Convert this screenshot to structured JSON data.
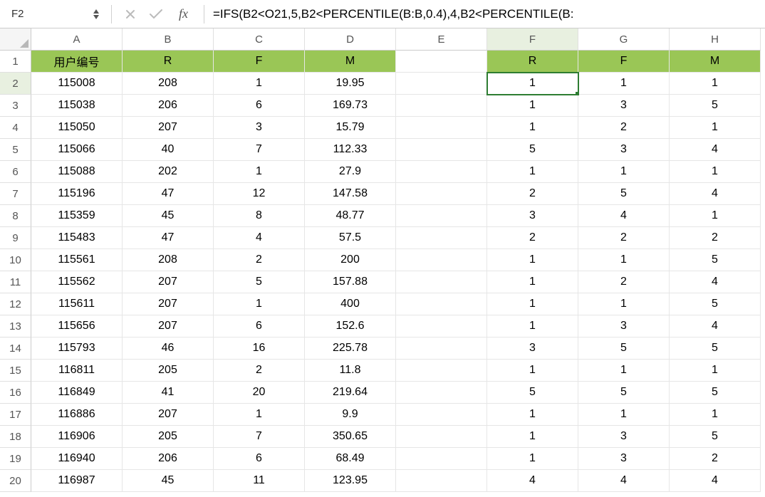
{
  "nameBox": "F2",
  "formula": "=IFS(B2<O21,5,B2<PERCENTILE(B:B,0.4),4,B2<PERCENTILE(B:",
  "columns": [
    "A",
    "B",
    "C",
    "D",
    "E",
    "F",
    "G",
    "H"
  ],
  "activeCol": "F",
  "activeRow": 2,
  "headerRow": {
    "A": "用户编号",
    "B": "R",
    "C": "F",
    "D": "M",
    "E": "",
    "F": "R",
    "G": "F",
    "H": "M"
  },
  "greenCols": [
    "A",
    "B",
    "C",
    "D",
    "F",
    "G",
    "H"
  ],
  "rows": [
    {
      "n": 2,
      "A": "115008",
      "B": "208",
      "C": "1",
      "D": "19.95",
      "E": "",
      "F": "1",
      "G": "1",
      "H": "1"
    },
    {
      "n": 3,
      "A": "115038",
      "B": "206",
      "C": "6",
      "D": "169.73",
      "E": "",
      "F": "1",
      "G": "3",
      "H": "5"
    },
    {
      "n": 4,
      "A": "115050",
      "B": "207",
      "C": "3",
      "D": "15.79",
      "E": "",
      "F": "1",
      "G": "2",
      "H": "1"
    },
    {
      "n": 5,
      "A": "115066",
      "B": "40",
      "C": "7",
      "D": "112.33",
      "E": "",
      "F": "5",
      "G": "3",
      "H": "4"
    },
    {
      "n": 6,
      "A": "115088",
      "B": "202",
      "C": "1",
      "D": "27.9",
      "E": "",
      "F": "1",
      "G": "1",
      "H": "1"
    },
    {
      "n": 7,
      "A": "115196",
      "B": "47",
      "C": "12",
      "D": "147.58",
      "E": "",
      "F": "2",
      "G": "5",
      "H": "4"
    },
    {
      "n": 8,
      "A": "115359",
      "B": "45",
      "C": "8",
      "D": "48.77",
      "E": "",
      "F": "3",
      "G": "4",
      "H": "1"
    },
    {
      "n": 9,
      "A": "115483",
      "B": "47",
      "C": "4",
      "D": "57.5",
      "E": "",
      "F": "2",
      "G": "2",
      "H": "2"
    },
    {
      "n": 10,
      "A": "115561",
      "B": "208",
      "C": "2",
      "D": "200",
      "E": "",
      "F": "1",
      "G": "1",
      "H": "5"
    },
    {
      "n": 11,
      "A": "115562",
      "B": "207",
      "C": "5",
      "D": "157.88",
      "E": "",
      "F": "1",
      "G": "2",
      "H": "4"
    },
    {
      "n": 12,
      "A": "115611",
      "B": "207",
      "C": "1",
      "D": "400",
      "E": "",
      "F": "1",
      "G": "1",
      "H": "5"
    },
    {
      "n": 13,
      "A": "115656",
      "B": "207",
      "C": "6",
      "D": "152.6",
      "E": "",
      "F": "1",
      "G": "3",
      "H": "4"
    },
    {
      "n": 14,
      "A": "115793",
      "B": "46",
      "C": "16",
      "D": "225.78",
      "E": "",
      "F": "3",
      "G": "5",
      "H": "5"
    },
    {
      "n": 15,
      "A": "116811",
      "B": "205",
      "C": "2",
      "D": "11.8",
      "E": "",
      "F": "1",
      "G": "1",
      "H": "1"
    },
    {
      "n": 16,
      "A": "116849",
      "B": "41",
      "C": "20",
      "D": "219.64",
      "E": "",
      "F": "5",
      "G": "5",
      "H": "5"
    },
    {
      "n": 17,
      "A": "116886",
      "B": "207",
      "C": "1",
      "D": "9.9",
      "E": "",
      "F": "1",
      "G": "1",
      "H": "1"
    },
    {
      "n": 18,
      "A": "116906",
      "B": "205",
      "C": "7",
      "D": "350.65",
      "E": "",
      "F": "1",
      "G": "3",
      "H": "5"
    },
    {
      "n": 19,
      "A": "116940",
      "B": "206",
      "C": "6",
      "D": "68.49",
      "E": "",
      "F": "1",
      "G": "3",
      "H": "2"
    },
    {
      "n": 20,
      "A": "116987",
      "B": "45",
      "C": "11",
      "D": "123.95",
      "E": "",
      "F": "4",
      "G": "4",
      "H": "4"
    }
  ]
}
